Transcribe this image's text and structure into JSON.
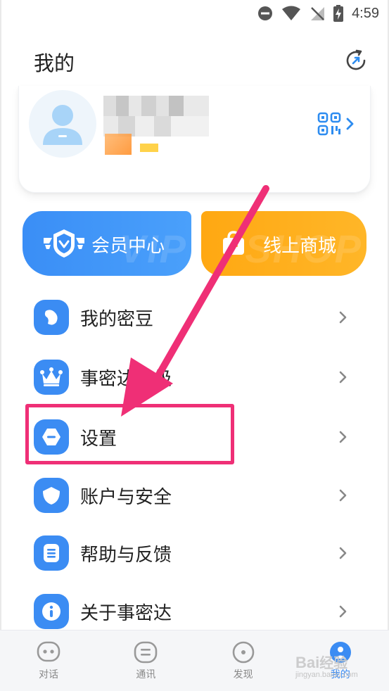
{
  "status_bar": {
    "time": "4:59",
    "icons": [
      "do-not-disturb-icon",
      "wifi-icon",
      "no-signal-icon",
      "battery-charging-icon"
    ]
  },
  "header": {
    "title": "我的",
    "refresh_icon": "refresh-icon"
  },
  "profile": {
    "avatar_icon": "user-avatar-icon",
    "qr_icon": "qr-code-icon",
    "chevron_icon": "chevron-right-icon"
  },
  "promos": [
    {
      "label": "会员中心",
      "watermark": "VIP",
      "icon": "vip-shield-icon",
      "color": "#3a8ef6"
    },
    {
      "label": "线上商城",
      "watermark": "SHOP",
      "icon": "shopping-bag-icon",
      "color": "#ffa812"
    }
  ],
  "menu": {
    "items": [
      {
        "label": "我的密豆",
        "icon": "bean-icon"
      },
      {
        "label": "事密达等级",
        "icon": "crown-icon"
      },
      {
        "label": "设置",
        "icon": "settings-icon"
      },
      {
        "label": "账户与安全",
        "icon": "shield-icon"
      },
      {
        "label": "帮助与反馈",
        "icon": "document-icon"
      },
      {
        "label": "关于事密达",
        "icon": "info-icon"
      }
    ]
  },
  "annotation": {
    "color": "#ef2f76"
  },
  "bottom_nav": {
    "items": [
      {
        "label": "对话",
        "icon": "chat-icon",
        "active": false
      },
      {
        "label": "通讯",
        "icon": "contacts-icon",
        "active": false
      },
      {
        "label": "发现",
        "icon": "discover-icon",
        "active": false
      },
      {
        "label": "我的",
        "icon": "profile-icon",
        "active": true
      }
    ]
  },
  "watermark": {
    "text": "Bai",
    "text2": "经验",
    "sub": "jingyan.baidu.com"
  }
}
